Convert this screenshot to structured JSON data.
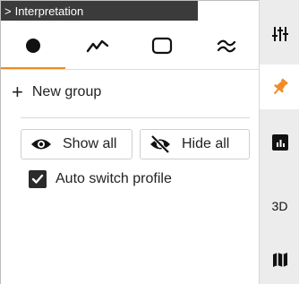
{
  "panel": {
    "title": "Interpretation",
    "tabs": [
      {
        "icon": "dot-icon",
        "active": true
      },
      {
        "icon": "line-icon",
        "active": false
      },
      {
        "icon": "rounded-rect-icon",
        "active": false
      },
      {
        "icon": "wave-icon",
        "active": false
      }
    ],
    "new_group_label": "New group",
    "show_all_label": "Show all",
    "hide_all_label": "Hide all",
    "auto_switch_label": "Auto switch profile",
    "auto_switch_checked": true
  },
  "rail": {
    "items": [
      {
        "icon": "sliders-icon"
      },
      {
        "icon": "pin-icon",
        "active": true
      },
      {
        "icon": "chart-icon"
      },
      {
        "label": "3D"
      },
      {
        "icon": "map-icon"
      }
    ]
  },
  "colors": {
    "accent": "#f08a24",
    "titlebar": "#3b3b3b",
    "rail_bg": "#ececec"
  }
}
